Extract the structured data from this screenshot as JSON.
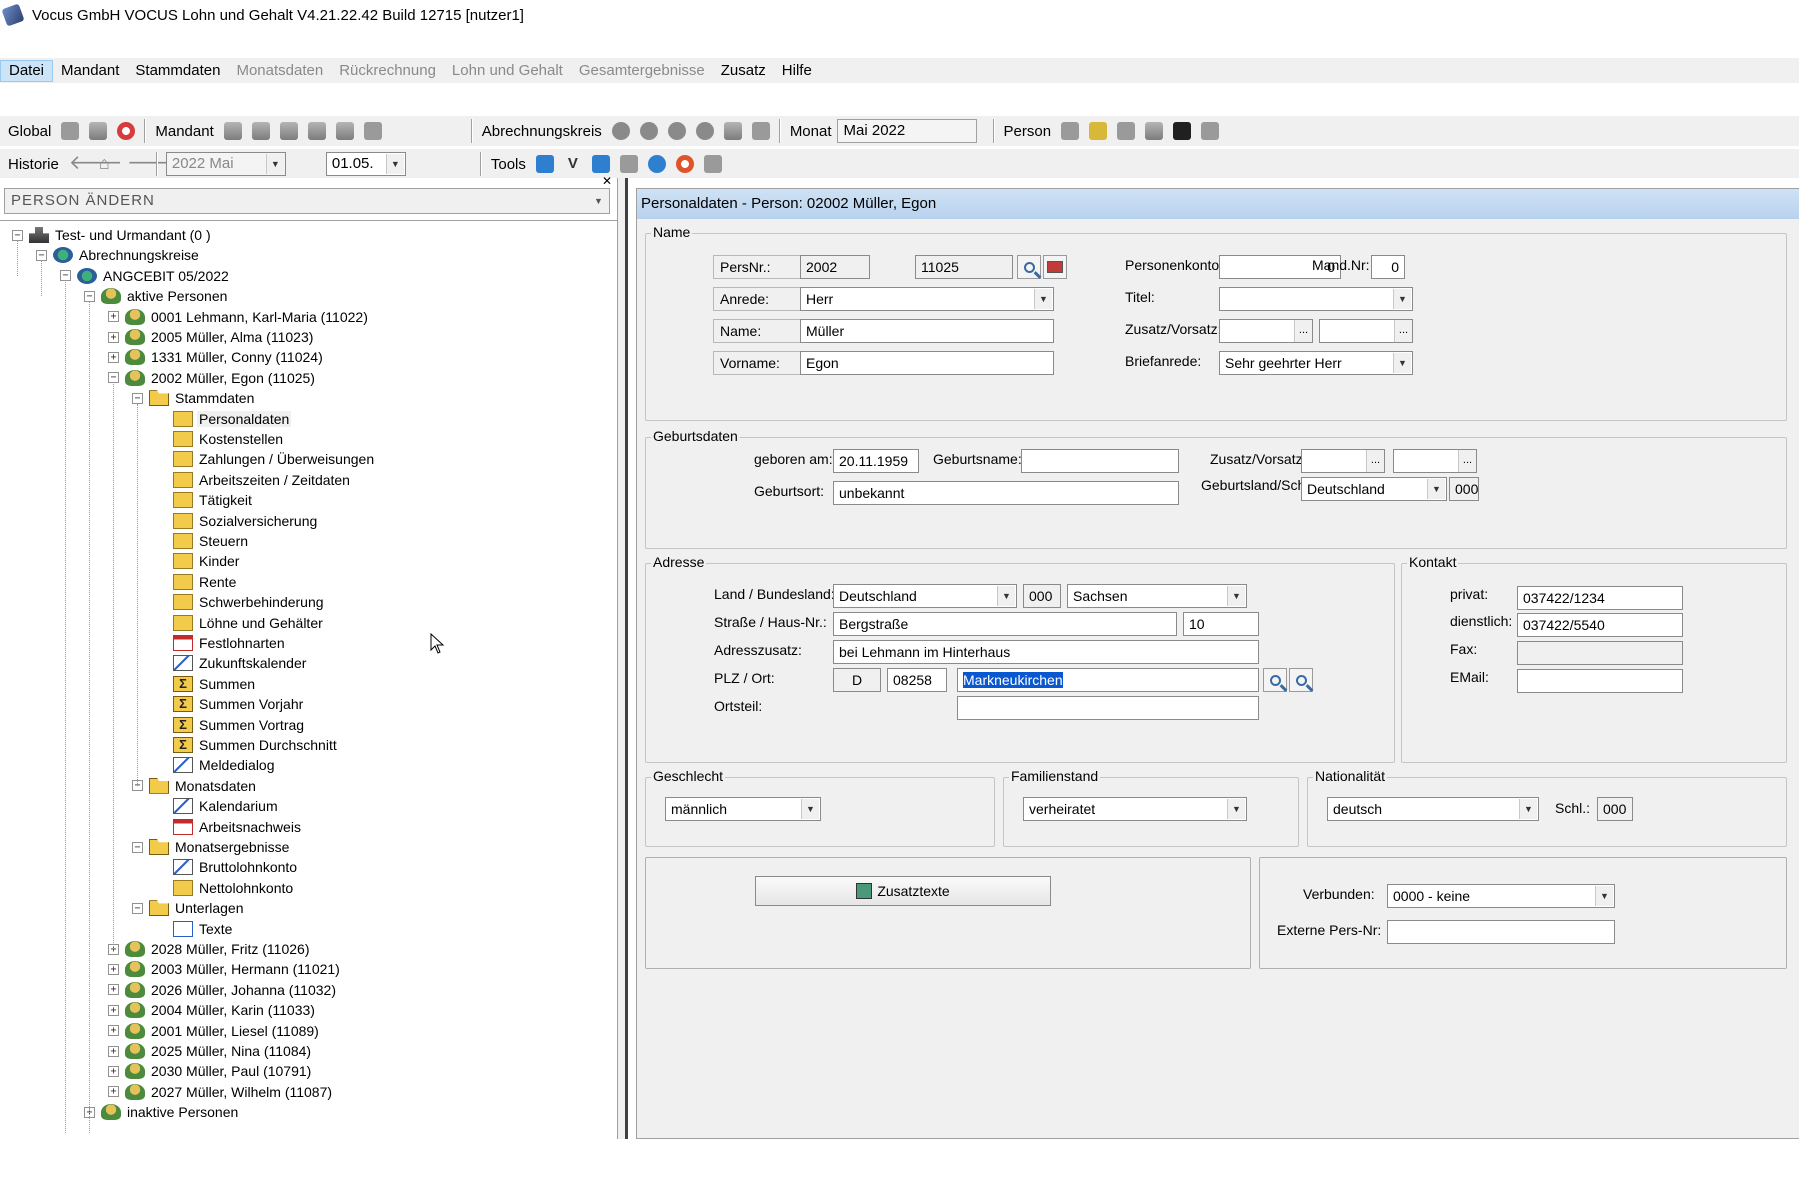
{
  "window": {
    "title": "Vocus GmbH VOCUS Lohn und Gehalt V4.21.22.42 Build 12715 [nutzer1]"
  },
  "menu": [
    "Datei",
    "Mandant",
    "Stammdaten",
    "Monatsdaten",
    "Rückrechnung",
    "Lohn und Gehalt",
    "Gesamtergebnisse",
    "Zusatz",
    "Hilfe"
  ],
  "toolbar": {
    "global_label": "Global",
    "mandant_label": "Mandant",
    "abrechnungskreis_label": "Abrechnungskreis",
    "monat_label": "Monat",
    "monat_value": "Mai 2022",
    "person_label": "Person",
    "historie_label": "Historie",
    "historie_month": "2022 Mai",
    "historie_day": "01.05.",
    "tools_label": "Tools"
  },
  "left": {
    "header": "PERSON ÄNDERN",
    "tree": [
      {
        "level": 0,
        "toggle": "-",
        "icon": "mandant",
        "text": "Test- und Urmandant  (0 )"
      },
      {
        "level": 1,
        "toggle": "-",
        "icon": "kreis",
        "text": "Abrechnungskreise"
      },
      {
        "level": 2,
        "toggle": "-",
        "icon": "kreis",
        "text": "ANGCEBIT  05/2022"
      },
      {
        "level": 3,
        "toggle": "-",
        "icon": "person",
        "text": "aktive Personen"
      },
      {
        "level": 4,
        "toggle": "+",
        "icon": "person",
        "text": "0001 Lehmann, Karl-Maria (11022)"
      },
      {
        "level": 4,
        "toggle": "+",
        "icon": "person",
        "text": "2005 Müller, Alma (11023)"
      },
      {
        "level": 4,
        "toggle": "+",
        "icon": "person",
        "text": "1331 Müller, Conny (11024)"
      },
      {
        "level": 4,
        "toggle": "-",
        "icon": "person",
        "text": "2002 Müller, Egon (11025)"
      },
      {
        "level": 5,
        "toggle": "-",
        "icon": "open",
        "text": "Stammdaten"
      },
      {
        "level": 6,
        "icon": "folder",
        "text": "Personaldaten",
        "selected": true
      },
      {
        "level": 6,
        "icon": "folder",
        "text": "Kostenstellen"
      },
      {
        "level": 6,
        "icon": "folder",
        "text": "Zahlungen / Überweisungen"
      },
      {
        "level": 6,
        "icon": "folder",
        "text": "Arbeitszeiten / Zeitdaten"
      },
      {
        "level": 6,
        "icon": "folder",
        "text": "Tätigkeit"
      },
      {
        "level": 6,
        "icon": "folder",
        "text": "Sozialversicherung"
      },
      {
        "level": 6,
        "icon": "folder",
        "text": "Steuern"
      },
      {
        "level": 6,
        "icon": "folder",
        "text": "Kinder"
      },
      {
        "level": 6,
        "icon": "folder",
        "text": "Rente"
      },
      {
        "level": 6,
        "icon": "folder",
        "text": "Schwerbehinderung"
      },
      {
        "level": 6,
        "icon": "folder",
        "text": "Löhne und Gehälter"
      },
      {
        "level": 6,
        "icon": "cal",
        "text": "Festlohnarten"
      },
      {
        "level": 6,
        "icon": "chart",
        "text": "Zukunftskalender"
      },
      {
        "level": 6,
        "icon": "sum",
        "text": "Summen"
      },
      {
        "level": 6,
        "icon": "sum",
        "text": "Summen Vorjahr"
      },
      {
        "level": 6,
        "icon": "sum",
        "text": "Summen Vortrag"
      },
      {
        "level": 6,
        "icon": "sum",
        "text": "Summen Durchschnitt"
      },
      {
        "level": 6,
        "icon": "chart",
        "text": "Meldedialog"
      },
      {
        "level": 5,
        "toggle": "-",
        "icon": "open",
        "text": "Monatsdaten"
      },
      {
        "level": 6,
        "icon": "chart",
        "text": "Kalendarium"
      },
      {
        "level": 6,
        "icon": "cal",
        "text": "Arbeitsnachweis"
      },
      {
        "level": 5,
        "toggle": "-",
        "icon": "open",
        "text": "Monatsergebnisse"
      },
      {
        "level": 6,
        "icon": "chart",
        "text": "Bruttolohnkonto"
      },
      {
        "level": 6,
        "icon": "folder",
        "text": "Nettolohnkonto"
      },
      {
        "level": 5,
        "toggle": "-",
        "icon": "open",
        "text": "Unterlagen"
      },
      {
        "level": 6,
        "icon": "text",
        "text": "Texte"
      },
      {
        "level": 4,
        "toggle": "+",
        "icon": "person",
        "text": "2028 Müller, Fritz (11026)"
      },
      {
        "level": 4,
        "toggle": "+",
        "icon": "person",
        "text": "2003 Müller, Hermann (11021)"
      },
      {
        "level": 4,
        "toggle": "+",
        "icon": "person",
        "text": "2026 Müller, Johanna (11032)"
      },
      {
        "level": 4,
        "toggle": "+",
        "icon": "person",
        "text": "2004 Müller, Karin (11033)"
      },
      {
        "level": 4,
        "toggle": "+",
        "icon": "person",
        "text": "2001 Müller, Liesel (11089)"
      },
      {
        "level": 4,
        "toggle": "+",
        "icon": "person",
        "text": "2025 Müller, Nina (11084)"
      },
      {
        "level": 4,
        "toggle": "+",
        "icon": "person",
        "text": "2030 Müller, Paul (10791)"
      },
      {
        "level": 4,
        "toggle": "+",
        "icon": "person",
        "text": "2027 Müller, Wilhelm (11087)"
      },
      {
        "level": 3,
        "toggle": "+",
        "icon": "person",
        "text": "inaktive Personen"
      }
    ]
  },
  "form": {
    "header": "Personaldaten - Person: 02002  Müller, Egon",
    "name": {
      "group": "Name",
      "persnr_label": "PersNr.:",
      "persnr": "2002",
      "persnr2": "11025",
      "anrede_label": "Anrede:",
      "anrede": "Herr",
      "name_label": "Name:",
      "name": "Müller",
      "vorname_label": "Vorname:",
      "vorname": "Egon",
      "personenkonto_label": "Personenkonto:",
      "personenkonto": "0",
      "mandnr_label": "Mand.Nr:",
      "mandnr": "0",
      "titel_label": "Titel:",
      "titel": "",
      "zusatz_label": "Zusatz/Vorsatz:",
      "briefanrede_label": "Briefanrede:",
      "briefanrede": "Sehr geehrter Herr"
    },
    "geburt": {
      "group": "Geburtsdaten",
      "geboren_label": "geboren am:",
      "geboren": "20.11.1959",
      "geburtsname_label": "Geburtsname:",
      "geburtsname": "",
      "zusatz_label": "Zusatz/Vorsatz:",
      "geburtsort_label": "Geburtsort:",
      "geburtsort": "unbekannt",
      "land_label": "Geburtsland/Schl.:",
      "land": "Deutschland",
      "land_schl": "000"
    },
    "adresse": {
      "group": "Adresse",
      "land_label": "Land / Bundesland:",
      "land": "Deutschland",
      "land_schl": "000",
      "bundesland": "Sachsen",
      "strasse_label": "Straße / Haus-Nr.:",
      "strasse": "Bergstraße",
      "hausnr": "10",
      "zusatz_label": "Adresszusatz:",
      "zusatz": "bei Lehmann im Hinterhaus",
      "plz_label": "PLZ / Ort:",
      "land_code": "D",
      "plz": "08258",
      "ort": "Markneukirchen",
      "ortsteil_label": "Ortsteil:",
      "ortsteil": ""
    },
    "kontakt": {
      "group": "Kontakt",
      "privat_label": "privat:",
      "privat": "037422/1234",
      "dienstlich_label": "dienstlich:",
      "dienstlich": "037422/5540",
      "fax_label": "Fax:",
      "fax": "",
      "email_label": "EMail:",
      "email": ""
    },
    "geschlecht": {
      "group": "Geschlecht",
      "value": "männlich"
    },
    "familienstand": {
      "group": "Familienstand",
      "value": "verheiratet"
    },
    "nationalitaet": {
      "group": "Nationalität",
      "value": "deutsch",
      "schl_label": "Schl.:",
      "schl": "000"
    },
    "zusatztexte_label": "Zusatztexte",
    "verbunden_label": "Verbunden:",
    "verbunden": "0000 - keine",
    "externe_label": "Externe Pers-Nr:",
    "externe": ""
  }
}
